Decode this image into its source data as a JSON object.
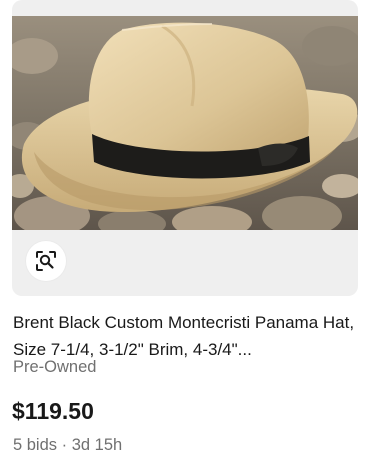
{
  "listing": {
    "title": "Brent Black Custom Montecristi Panama Hat, Size 7-1/4, 3-1/2\" Brim, 4-3/4\"...",
    "condition": "Pre-Owned",
    "price": "$119.50",
    "bids": "5 bids",
    "separator": "·",
    "time_left": "3d 15h",
    "image_alt": "Panama hat with black band on rocks"
  },
  "icons": {
    "visual_search": "image-search-icon"
  },
  "colors": {
    "text_primary": "#191919",
    "text_secondary": "#707070",
    "image_panel_bg": "#efefef"
  }
}
